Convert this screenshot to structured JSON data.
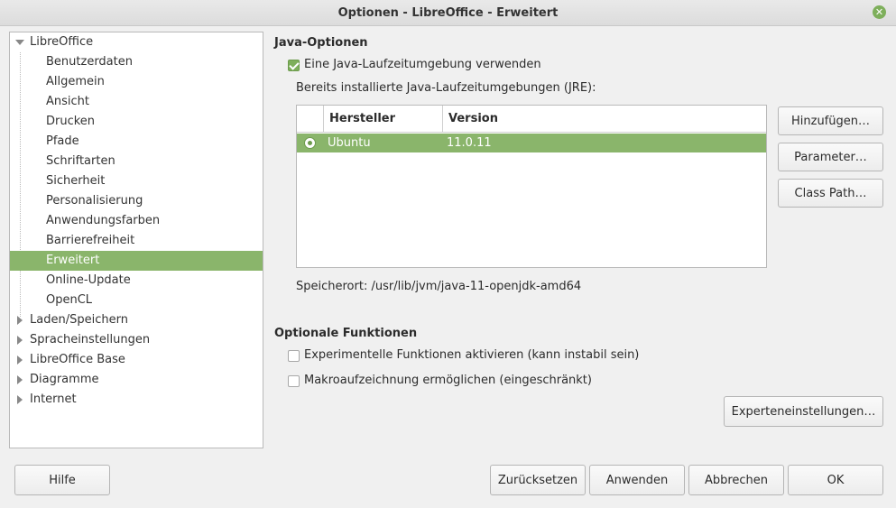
{
  "window": {
    "title": "Optionen - LibreOffice - Erweitert"
  },
  "tree": {
    "items": [
      {
        "label": "LibreOffice",
        "level": 0,
        "expanded": true
      },
      {
        "label": "Benutzerdaten",
        "level": 1
      },
      {
        "label": "Allgemein",
        "level": 1
      },
      {
        "label": "Ansicht",
        "level": 1
      },
      {
        "label": "Drucken",
        "level": 1
      },
      {
        "label": "Pfade",
        "level": 1
      },
      {
        "label": "Schriftarten",
        "level": 1
      },
      {
        "label": "Sicherheit",
        "level": 1
      },
      {
        "label": "Personalisierung",
        "level": 1
      },
      {
        "label": "Anwendungsfarben",
        "level": 1
      },
      {
        "label": "Barrierefreiheit",
        "level": 1
      },
      {
        "label": "Erweitert",
        "level": 1,
        "selected": true
      },
      {
        "label": "Online-Update",
        "level": 1
      },
      {
        "label": "OpenCL",
        "level": 1
      },
      {
        "label": "Laden/Speichern",
        "level": 0,
        "expanded": false
      },
      {
        "label": "Spracheinstellungen",
        "level": 0,
        "expanded": false
      },
      {
        "label": "LibreOffice Base",
        "level": 0,
        "expanded": false
      },
      {
        "label": "Diagramme",
        "level": 0,
        "expanded": false
      },
      {
        "label": "Internet",
        "level": 0,
        "expanded": false
      }
    ]
  },
  "java": {
    "section_title": "Java-Optionen",
    "use_jre_label": "Eine Java-Laufzeitumgebung verwenden",
    "use_jre_checked": true,
    "installed_label": "Bereits installierte Java-Laufzeitumgebungen (JRE):",
    "table": {
      "columns": [
        "Hersteller",
        "Version"
      ],
      "rows": [
        {
          "vendor": "Ubuntu",
          "version": "11.0.11",
          "selected": true
        }
      ]
    },
    "location": "Speicherort: /usr/lib/jvm/java-11-openjdk-amd64",
    "buttons": {
      "add": "Hinzufügen…",
      "parameters": "Parameter…",
      "classpath": "Class Path…"
    }
  },
  "optional": {
    "section_title": "Optionale Funktionen",
    "experimental_label": "Experimentelle Funktionen aktivieren (kann instabil sein)",
    "experimental_checked": false,
    "macro_label": "Makroaufzeichnung ermöglichen (eingeschränkt)",
    "macro_checked": false,
    "expert_button": "Experteneinstellungen…"
  },
  "footer": {
    "help": "Hilfe",
    "reset": "Zurücksetzen",
    "apply": "Anwenden",
    "cancel": "Abbrechen",
    "ok": "OK"
  },
  "colors": {
    "accent": "#8ab56b",
    "close": "#7eaf5b"
  }
}
